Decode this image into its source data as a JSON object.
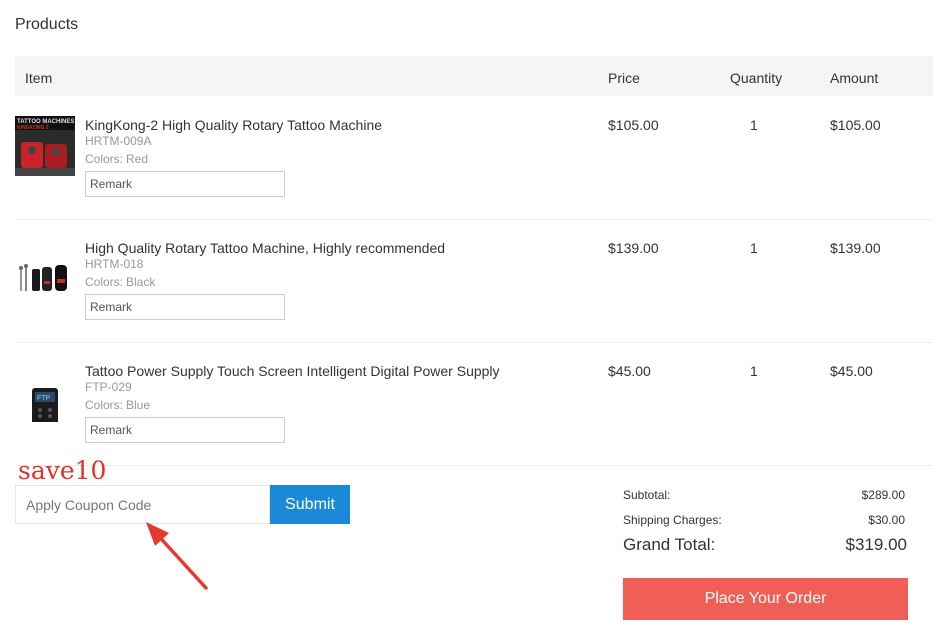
{
  "section_title": "Products",
  "columns": {
    "item": "Item",
    "price": "Price",
    "quantity": "Quantity",
    "amount": "Amount"
  },
  "items": [
    {
      "name": "KingKong-2 High Quality Rotary Tattoo Machine",
      "sku": "HRTM-009A",
      "colors_label": "Colors:",
      "color": "Red",
      "remark_placeholder": "Remark",
      "price": "$105.00",
      "quantity": "1",
      "amount": "$105.00",
      "thumb_icon": "tattoo-machine-red-thumbnail"
    },
    {
      "name": "High Quality Rotary Tattoo Machine, Highly recommended",
      "sku": "HRTM-018",
      "colors_label": "Colors:",
      "color": "Black",
      "remark_placeholder": "Remark",
      "price": "$139.00",
      "quantity": "1",
      "amount": "$139.00",
      "thumb_icon": "tattoo-machine-black-thumbnail"
    },
    {
      "name": "Tattoo Power Supply Touch Screen Intelligent Digital Power Supply",
      "sku": "FTP-029",
      "colors_label": "Colors:",
      "color": "Blue",
      "remark_placeholder": "Remark",
      "price": "$45.00",
      "quantity": "1",
      "amount": "$45.00",
      "thumb_icon": "power-supply-thumbnail"
    }
  ],
  "coupon": {
    "annotation": "save10",
    "placeholder": "Apply Coupon Code",
    "value": "",
    "submit_label": "Submit"
  },
  "summary": {
    "subtotal_label": "Subtotal:",
    "subtotal": "$289.00",
    "shipping_label": "Shipping Charges:",
    "shipping": "$30.00",
    "grand_total_label": "Grand Total:",
    "grand_total": "$319.00"
  },
  "place_order_label": "Place Your Order",
  "colors": {
    "submit": "#1a8ad8",
    "place_order": "#f05f55",
    "annotation": "#e0322a"
  }
}
